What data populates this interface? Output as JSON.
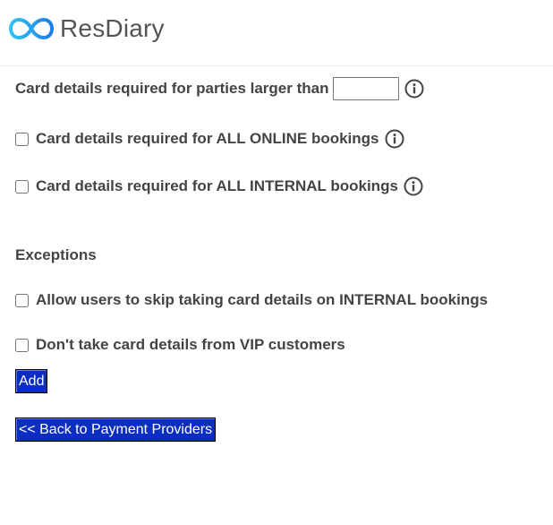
{
  "brand": {
    "name": "ResDiary",
    "logo_colors": [
      "#2ec4f0",
      "#1f7ee8"
    ]
  },
  "card_rules": {
    "party_label": "Card details required for parties larger than",
    "party_value": "",
    "online_label_pre": "Card details required for ",
    "online_label_bold": "ALL ONLINE",
    "online_label_post": " bookings",
    "online_checked": false,
    "internal_label_pre": "Card details required for ",
    "internal_label_bold": "ALL INTERNAL",
    "internal_label_post": " bookings",
    "internal_checked": false
  },
  "exceptions": {
    "title": "Exceptions",
    "skip_internal_label": "Allow users to skip taking card details on INTERNAL bookings",
    "skip_internal_checked": false,
    "vip_label": "Don't take card details from VIP customers",
    "vip_checked": false
  },
  "buttons": {
    "add_label": "Add",
    "back_label": "<< Back to Payment Providers",
    "button_color": "#0b2dc2"
  },
  "icons": {
    "info": "info-circle-icon"
  }
}
